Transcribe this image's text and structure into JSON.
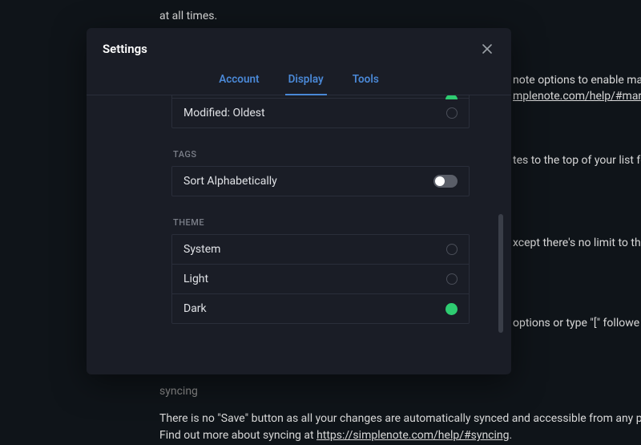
{
  "background": {
    "line1": "at all times.",
    "line2a": "note options to enable mar",
    "line2b": "mplenote.com/help/#marko",
    "line3": "tes to the top of your list fo",
    "line4": "xcept there's no limit to the",
    "line5": "options or type \"[\" followe",
    "line6": "syncing",
    "line7a": "There is no \"Save\" button as all your changes are automatically synced and accessible from any plat",
    "line7b_prefix": "Find out more about syncing at ",
    "line7b_link": "https://simplenote.com/help/#syncing",
    "line7b_suffix": "."
  },
  "modal": {
    "title": "Settings",
    "tabs": {
      "account": "Account",
      "display": "Display",
      "tools": "Tools"
    },
    "sort": {
      "option_modified_oldest": "Modified: Oldest"
    },
    "tags": {
      "section": "Tags",
      "sort_alpha": "Sort Alphabetically"
    },
    "theme": {
      "section": "Theme",
      "system": "System",
      "light": "Light",
      "dark": "Dark"
    }
  }
}
